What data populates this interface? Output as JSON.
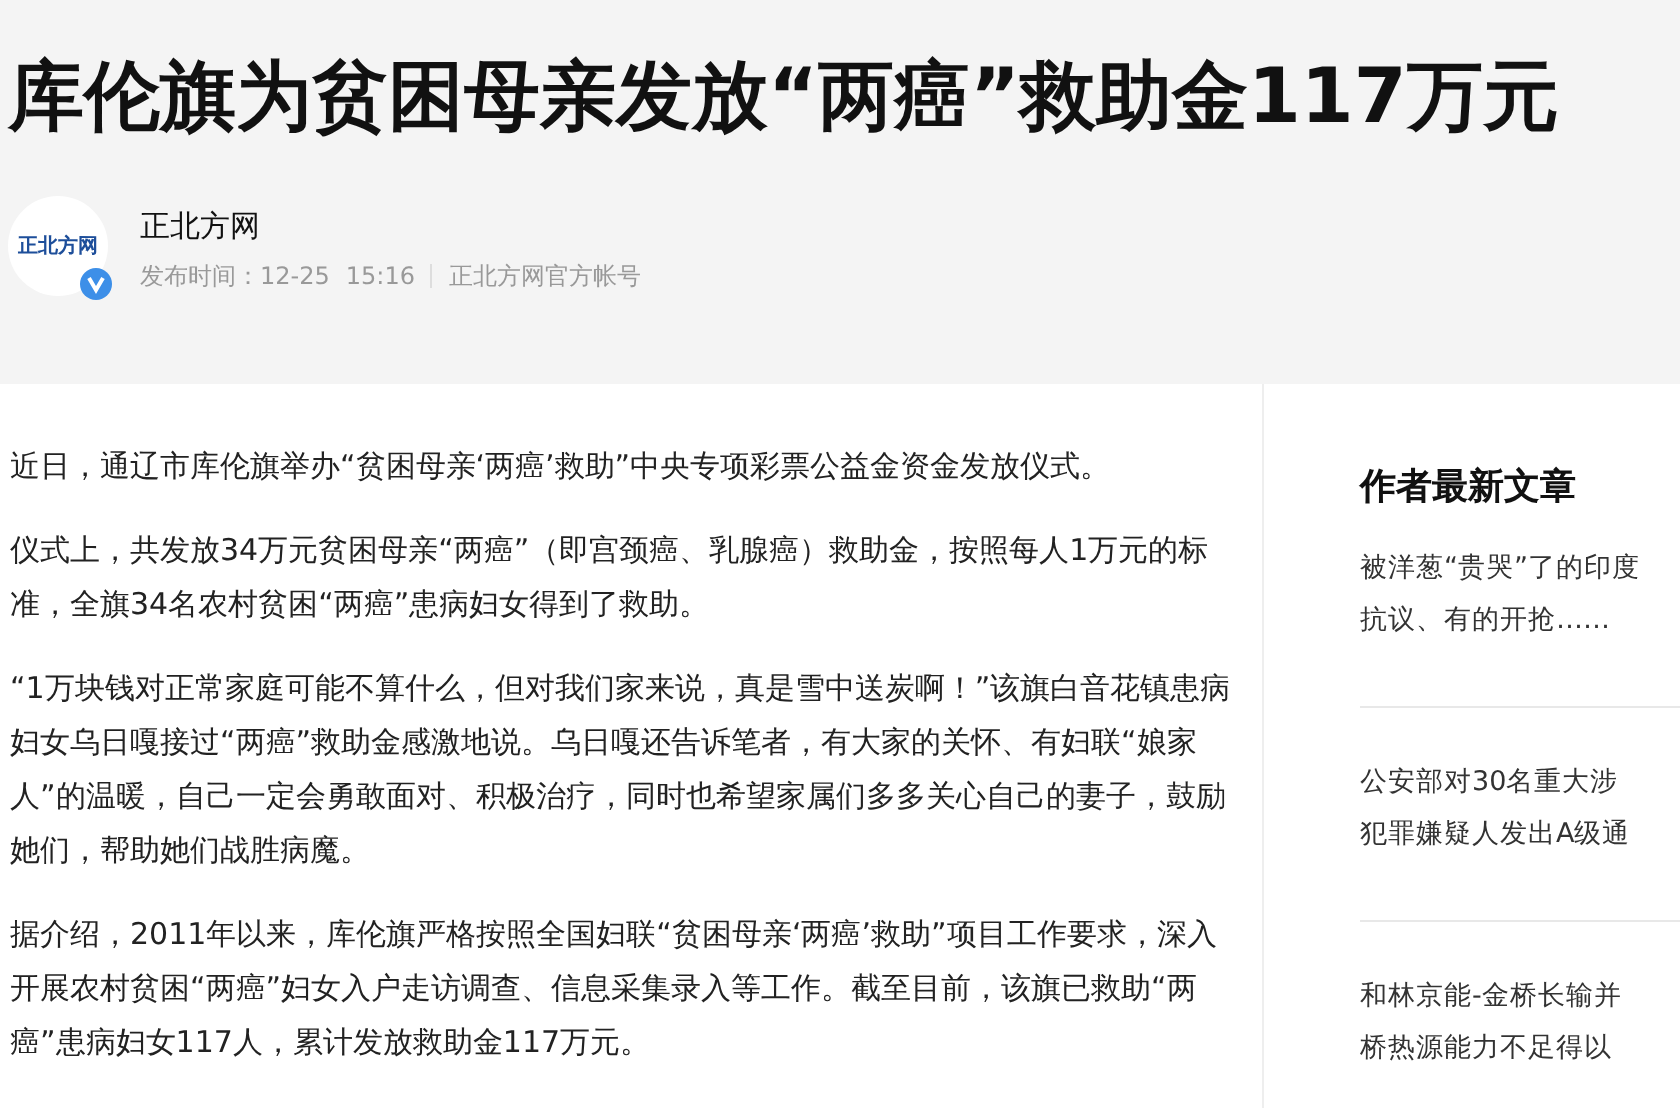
{
  "article": {
    "title": "库伦旗为贫困母亲发放“两癌”救助金117万元",
    "author": {
      "avatar_text": "正北方网",
      "verified": true,
      "name": "正北方网",
      "publish_label": "发布时间：12-25",
      "time": "15:16",
      "account": "正北方网官方帐号"
    },
    "paragraphs": [
      "近日，通辽市库伦旗举办“贫困母亲‘两癌’救助”中央专项彩票公益金资金发放仪式。",
      "仪式上，共发放34万元贫困母亲“两癌”（即宫颈癌、乳腺癌）救助金，按照每人1万元的标准，全旗34名农村贫困“两癌”患病妇女得到了救助。",
      "“1万块钱对正常家庭可能不算什么，但对我们家来说，真是雪中送炭啊！”该旗白音花镇患病妇女乌日嘎接过“两癌”救助金感激地说。乌日嘎还告诉笔者，有大家的关怀、有妇联“娘家人”的温暖，自己一定会勇敢面对、积极治疗，同时也希望家属们多多关心自己的妻子，鼓励她们，帮助她们战胜病魔。",
      "据介绍，2011年以来，库伦旗严格按照全国妇联“贫困母亲‘两癌’救助”项目工作要求，深入开展农村贫困“两癌”妇女入户走访调查、信息采集录入等工作。截至目前，该旗已救助“两癌”患病妇女117人，累计发放救助金117万元。"
    ]
  },
  "sidebar": {
    "heading": "作者最新文章",
    "items": [
      {
        "lines": [
          "被洋葱“贵哭”了的印度",
          "抗议、有的开抢……"
        ]
      },
      {
        "lines": [
          "公安部对30名重大涉",
          "犯罪嫌疑人发出A级通"
        ]
      },
      {
        "lines": [
          "和林京能-金桥长输并",
          "桥热源能力不足得以"
        ]
      }
    ]
  }
}
